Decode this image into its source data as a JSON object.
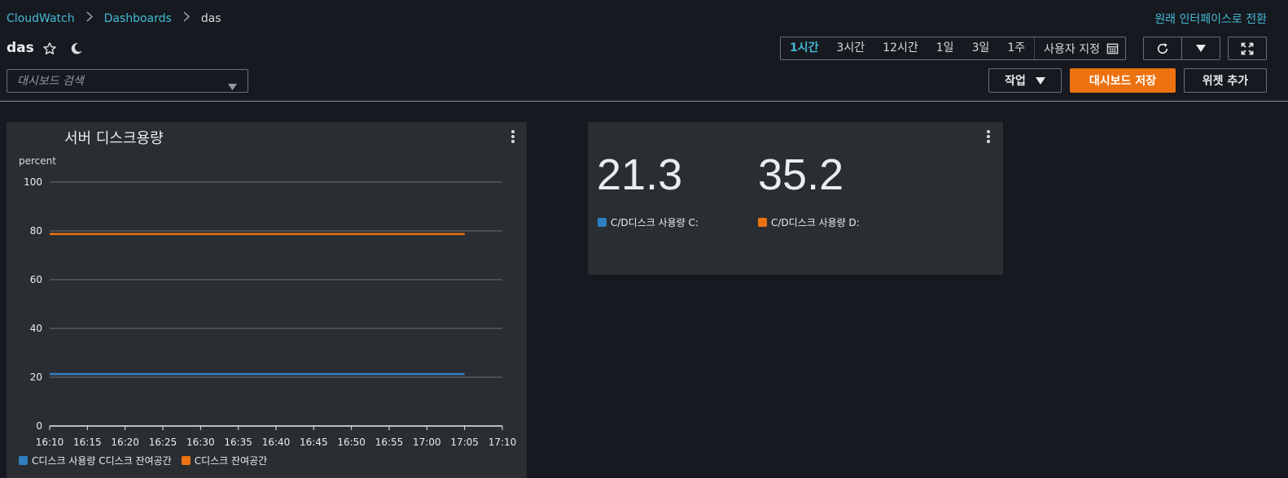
{
  "breadcrumb": {
    "items": [
      "CloudWatch",
      "Dashboards"
    ],
    "current": "das"
  },
  "switch_ui_link": "원래 인터페이스로 전환",
  "dashboard": {
    "title": "das"
  },
  "search": {
    "placeholder": "대시보드 검색"
  },
  "time_range": {
    "options": [
      "1시간",
      "3시간",
      "12시간",
      "1일",
      "3일",
      "1주"
    ],
    "active": "1시간",
    "custom_label": "사용자 지정"
  },
  "actions": {
    "actions_label": "작업",
    "save_label": "대시보드 저장",
    "add_widget_label": "위젯 추가"
  },
  "colors": {
    "series_blue": "#2f7fc1",
    "series_orange": "#ec7211",
    "accent_link": "#44b9d6"
  },
  "line_widget": {
    "title": "서버 디스크용량",
    "unit_label": "percent",
    "legend": [
      "C디스크 사용량 C디스크 잔여공간",
      "C디스크 잔여공간"
    ],
    "chart_data": {
      "type": "line",
      "title": "서버 디스크용량",
      "ylabel": "percent",
      "ylim": [
        0,
        100
      ],
      "yticks": [
        0,
        20,
        40,
        60,
        80,
        100
      ],
      "x": [
        "16:10",
        "16:15",
        "16:20",
        "16:25",
        "16:30",
        "16:35",
        "16:40",
        "16:45",
        "16:50",
        "16:55",
        "17:00",
        "17:05",
        "17:10"
      ],
      "series": [
        {
          "name": "C디스크 사용량 C디스크 잔여공간",
          "color": "#2f7fc1",
          "x_range": [
            "16:10",
            "17:05"
          ],
          "values": [
            21.3,
            21.3
          ]
        },
        {
          "name": "C디스크 잔여공간",
          "color": "#ec7211",
          "x_range": [
            "16:10",
            "17:05"
          ],
          "values": [
            78.7,
            78.7
          ]
        }
      ],
      "grid": true,
      "legend_position": "bottom-left"
    }
  },
  "number_widget": {
    "items": [
      {
        "value": "21.3",
        "label": "C/D디스크 사용량 C:",
        "color": "#2f7fc1"
      },
      {
        "value": "35.2",
        "label": "C/D디스크 사용량 D:",
        "color": "#ec7211"
      }
    ]
  }
}
